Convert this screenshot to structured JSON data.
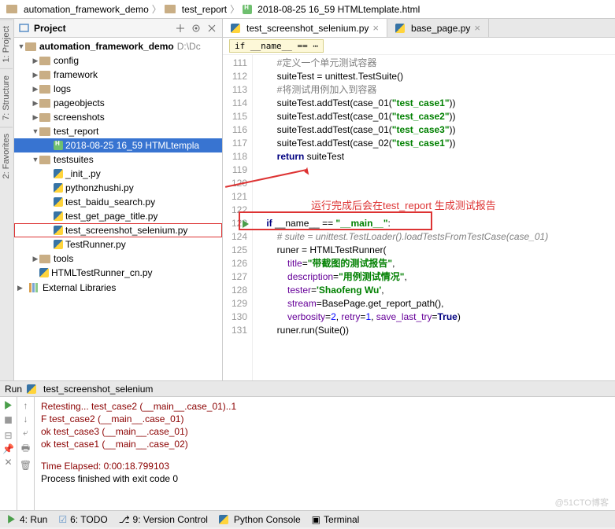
{
  "breadcrumb": {
    "root": "automation_framework_demo",
    "mid": "test_report",
    "leaf": "2018-08-25 16_59 HTMLtemplate.html"
  },
  "project": {
    "title": "Project",
    "root": "automation_framework_demo",
    "root_path": "D:\\Dc",
    "nodes": [
      {
        "label": "config"
      },
      {
        "label": "framework"
      },
      {
        "label": "logs"
      },
      {
        "label": "pageobjects"
      },
      {
        "label": "screenshots"
      },
      {
        "label": "test_report"
      }
    ],
    "selected_file": "2018-08-25 16_59 HTMLtempla",
    "testsuites": "testsuites",
    "ts_files": [
      "_init_.py",
      "pythonzhushi.py",
      "test_baidu_search.py",
      "test_get_page_title.py",
      "test_screenshot_selenium.py",
      "TestRunner.py"
    ],
    "tools": "tools",
    "runner_file": "HTMLTestRunner_cn.py",
    "ext_lib": "External Libraries"
  },
  "tabs": {
    "active": "test_screenshot_selenium.py",
    "other": "base_page.py"
  },
  "crumb_chip": "if __name__ == ⋯",
  "code": {
    "line_nums": [
      "111",
      "112",
      "113",
      "114",
      "115",
      "116",
      "117",
      "118",
      "119",
      "120",
      "121",
      "122",
      "123",
      "124",
      "125",
      "126",
      "127",
      "128",
      "129",
      "130",
      "131"
    ],
    "c111": "#定义一个单元测试容器",
    "c112a": "suiteTest = unittest.TestSuite()",
    "c113": "#将测试用例加入到容器",
    "c114_suite": "suiteTest.addTest(case_01(",
    "c114_str": "\"test_case1\"",
    "c115_str": "\"test_case2\"",
    "c116_str": "\"test_case3\"",
    "c117_pre": "suiteTest.addTest(case_02(",
    "c117_str": "\"test_case1\"",
    "c118_kw": "return",
    "c118_val": " suiteTest",
    "c123_if": "if",
    "c123_name": " __name__ == ",
    "c123_main": "\"__main__\"",
    "c124": "# suite = unittest.TestLoader().loadTestsFromTestCase(case_01)",
    "c125": "runer = HTMLTestRunner(",
    "c126_k": "title",
    "c126_v": "\"带截图的测试报告\"",
    "c127_k": "description",
    "c127_v": "\"用例测试情况\"",
    "c128_k": "tester",
    "c128_v": "'Shaofeng Wu'",
    "c129_k": "stream",
    "c129_v": "BasePage.get_report_path()",
    "c130_k": "verbosity",
    "c130_v1": "2",
    "c130_r": "retry",
    "c130_v2": "1",
    "c130_s": "save_last_try",
    "c130_v3": "True",
    "c131": "runer.run(Suite())"
  },
  "annotation": "运行完成后会在test_report 生成测试报告",
  "run": {
    "title": "Run",
    "config": "test_screenshot_selenium",
    "lines": {
      "l1": "Retesting... test_case2 (__main__.case_01)..1",
      "l2": "F  test_case2 (__main__.case_01)",
      "l3": "ok test_case3 (__main__.case_01)",
      "l4": "ok test_case1 (__main__.case_02)",
      "l5": "Time Elapsed: 0:00:18.799103",
      "l6": "Process finished with exit code 0"
    }
  },
  "bottom": {
    "run": "4: Run",
    "todo": "6: TODO",
    "vc": "9: Version Control",
    "pc": "Python Console",
    "term": "Terminal"
  },
  "watermark": "@51CTO博客"
}
